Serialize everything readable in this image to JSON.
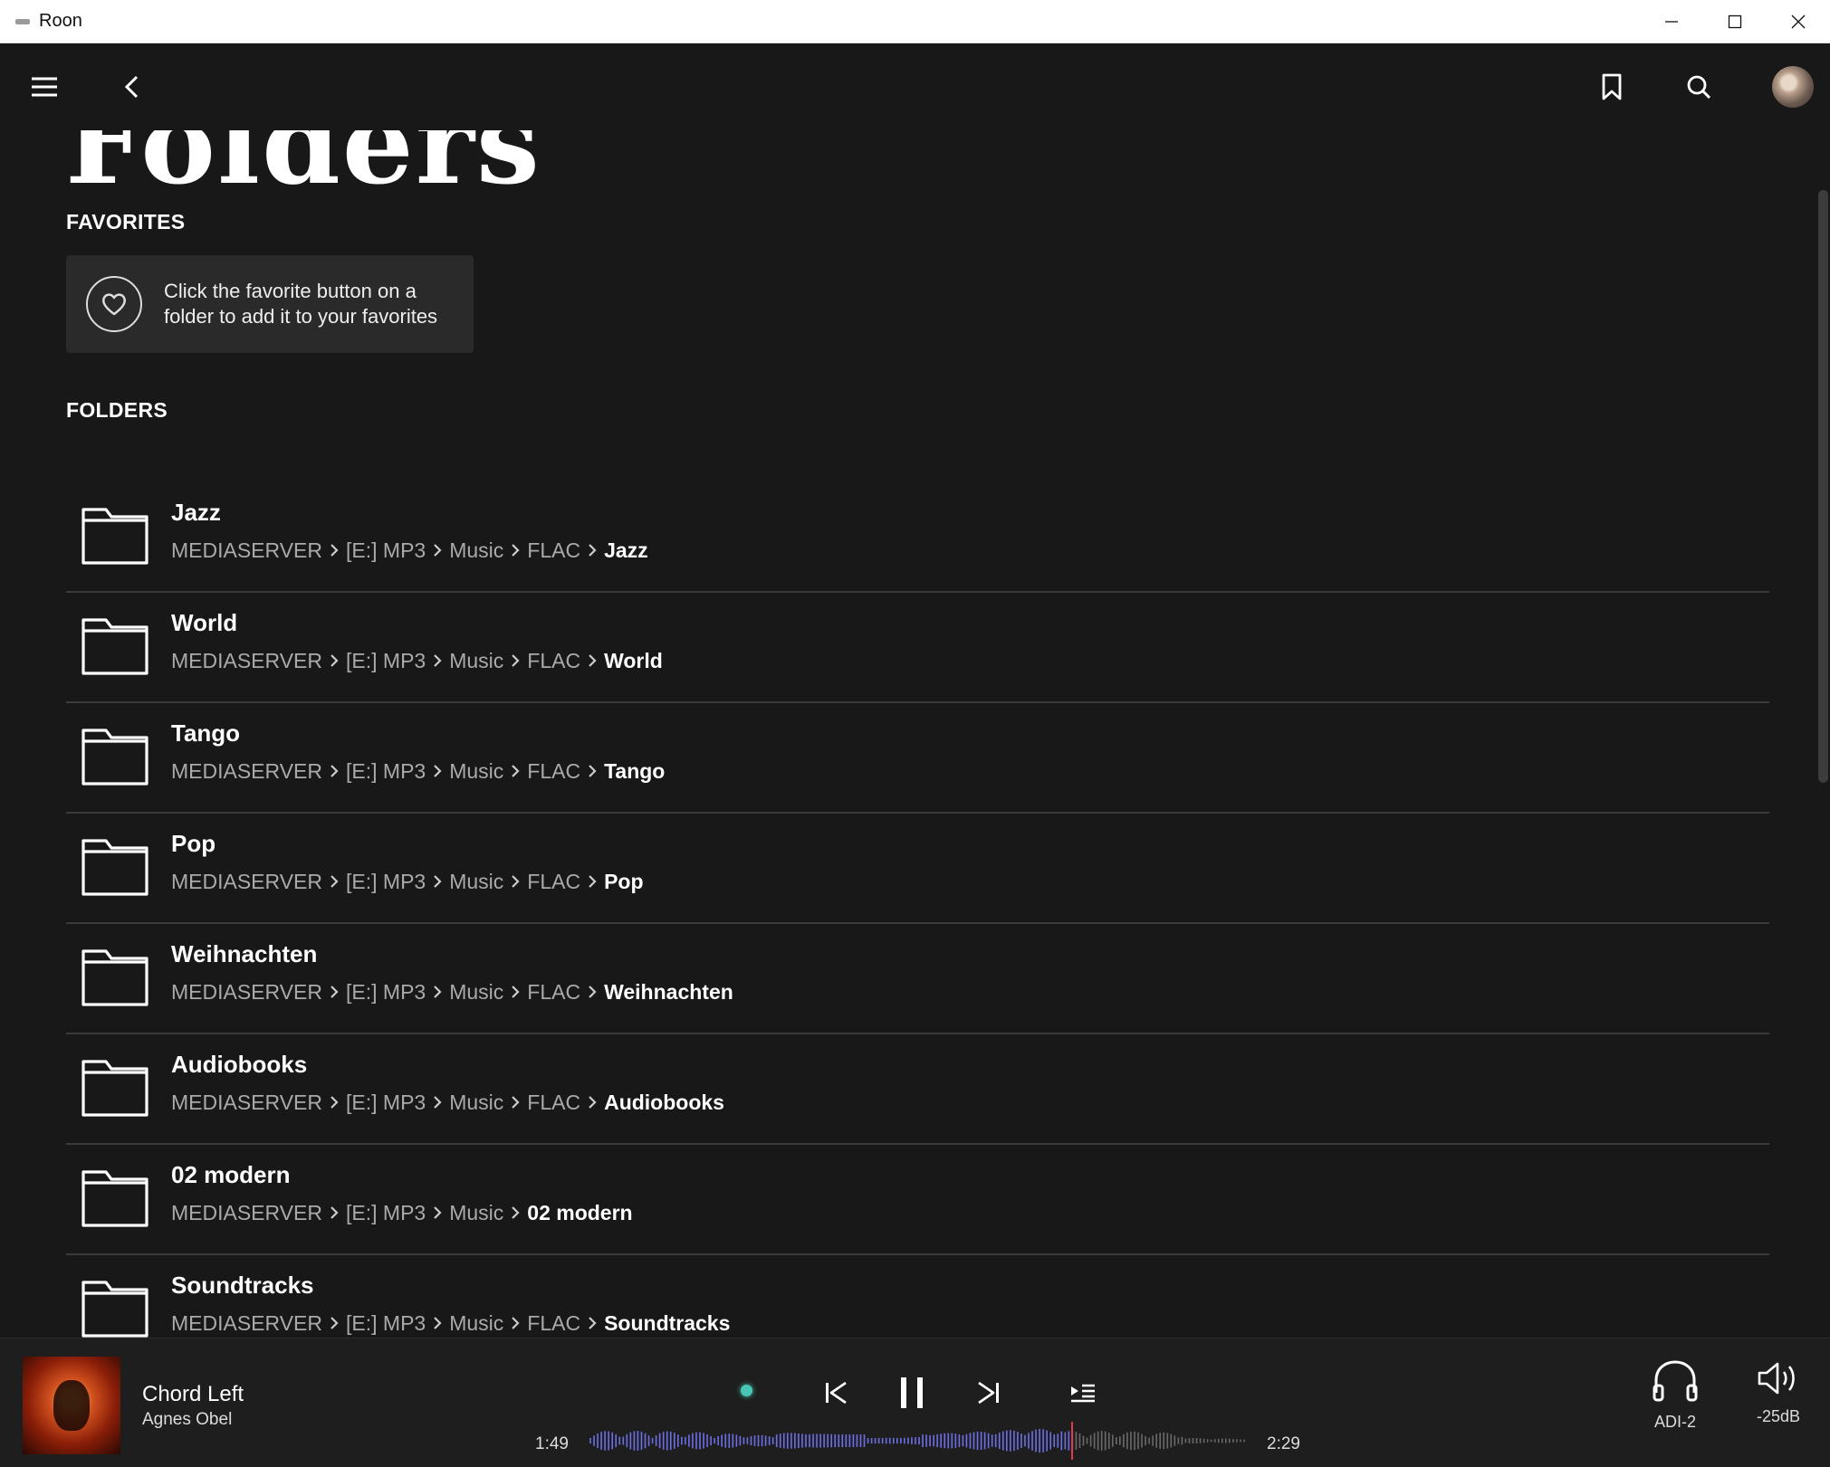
{
  "window": {
    "title": "Roon",
    "minimize_icon": "minimize-icon",
    "maximize_icon": "maximize-icon",
    "close_icon": "close-icon"
  },
  "page": {
    "title": "Folders",
    "favorites_heading": "FAVORITES",
    "favorites_hint": "Click the favorite button on a folder to add it to your favorites",
    "folders_heading": "FOLDERS"
  },
  "folders": [
    {
      "name": "Jazz",
      "path": [
        "MEDIASERVER",
        "[E:] MP3",
        "Music",
        "FLAC",
        "Jazz"
      ]
    },
    {
      "name": "World",
      "path": [
        "MEDIASERVER",
        "[E:] MP3",
        "Music",
        "FLAC",
        "World"
      ]
    },
    {
      "name": "Tango",
      "path": [
        "MEDIASERVER",
        "[E:] MP3",
        "Music",
        "FLAC",
        "Tango"
      ]
    },
    {
      "name": "Pop",
      "path": [
        "MEDIASERVER",
        "[E:] MP3",
        "Music",
        "FLAC",
        "Pop"
      ]
    },
    {
      "name": "Weihnachten",
      "path": [
        "MEDIASERVER",
        "[E:] MP3",
        "Music",
        "FLAC",
        "Weihnachten"
      ]
    },
    {
      "name": "Audiobooks",
      "path": [
        "MEDIASERVER",
        "[E:] MP3",
        "Music",
        "FLAC",
        "Audiobooks"
      ]
    },
    {
      "name": "02 modern",
      "path": [
        "MEDIASERVER",
        "[E:] MP3",
        "Music",
        "02 modern"
      ]
    },
    {
      "name": "Soundtracks",
      "path": [
        "MEDIASERVER",
        "[E:] MP3",
        "Music",
        "FLAC",
        "Soundtracks"
      ]
    }
  ],
  "player": {
    "track_title": "Chord Left",
    "artist": "Agnes Obel",
    "elapsed": "1:49",
    "total": "2:29",
    "progress": 0.731,
    "output_device": "ADI-2",
    "volume": "-25dB",
    "status_color": "#49c6b4",
    "waveform_color": "#6e6ee8",
    "playhead_color": "#e23a4e"
  }
}
